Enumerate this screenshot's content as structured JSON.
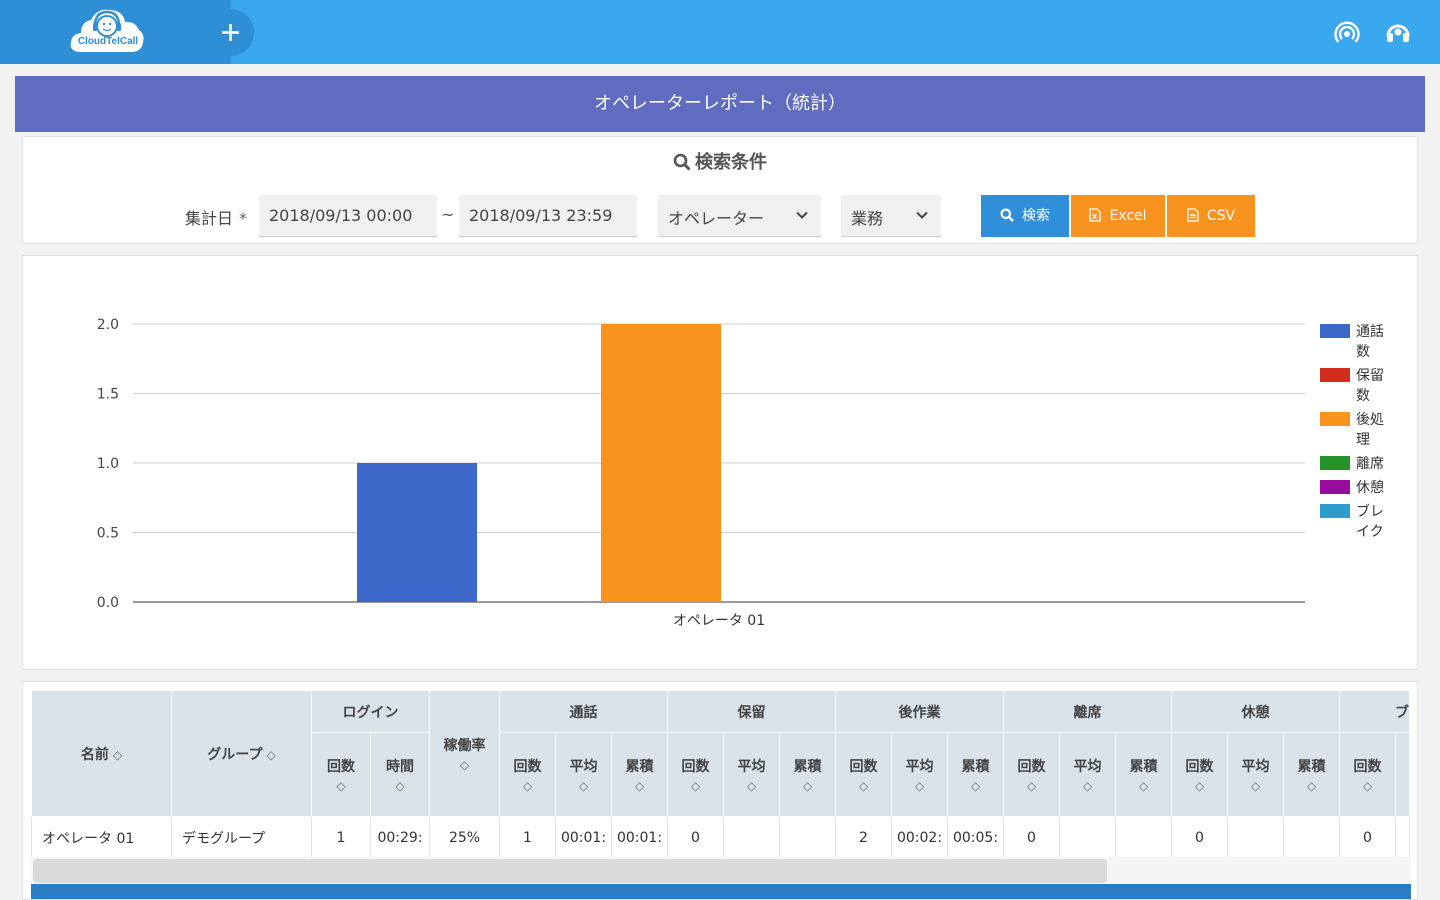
{
  "header": {
    "logo_text": "CloudTelCall",
    "brand_color": "#39a8ef",
    "logo_bg": "#2e8fd6",
    "icons": [
      "plus-icon",
      "broadcast-icon",
      "headset-icon"
    ]
  },
  "title": "オペレーターレポート（統計）",
  "search": {
    "heading": "検索条件",
    "date_label": "集計日",
    "required_mark": "*",
    "date_from": "2018/09/13 00:00",
    "tilde": "~",
    "date_to": "2018/09/13 23:59",
    "operator_select": "オペレーター",
    "task_select": "業務",
    "search_button": "検索",
    "excel_button": "Excel",
    "csv_button": "CSV"
  },
  "chart_data": {
    "type": "bar",
    "categories": [
      "オペレータ 01"
    ],
    "series": [
      {
        "name": "通話数",
        "values": [
          1
        ],
        "color": "#3d67c9"
      },
      {
        "name": "保留数",
        "values": [
          0
        ],
        "color": "#d42b1f"
      },
      {
        "name": "後処理",
        "values": [
          2
        ],
        "color": "#f7931e"
      },
      {
        "name": "離席",
        "values": [
          0
        ],
        "color": "#26922c"
      },
      {
        "name": "休憩",
        "values": [
          0
        ],
        "color": "#960c9a"
      },
      {
        "name": "ブレイク",
        "values": [
          0
        ],
        "color": "#2e9ccc"
      }
    ],
    "yticks": [
      "0.0",
      "0.5",
      "1.0",
      "1.5",
      "2.0"
    ],
    "ylim": [
      0,
      2
    ],
    "grid": true,
    "legend": "right"
  },
  "legend": {
    "items": [
      {
        "name": "通話数",
        "line1": "通話",
        "line2": "数",
        "color": "#3d67c9"
      },
      {
        "name": "保留数",
        "line1": "保留",
        "line2": "数",
        "color": "#d42b1f"
      },
      {
        "name": "後処理",
        "line1": "後処",
        "line2": "理",
        "color": "#f7931e"
      },
      {
        "name": "離席",
        "line1": "離席",
        "line2": "",
        "color": "#26922c"
      },
      {
        "name": "休憩",
        "line1": "休憩",
        "line2": "",
        "color": "#960c9a"
      },
      {
        "name": "ブレイク",
        "line1": "ブレ",
        "line2": "イク",
        "color": "#2e9ccc"
      }
    ]
  },
  "table": {
    "groups": {
      "login": "ログイン",
      "util": "稼働率",
      "call": "通話",
      "hold": "保留",
      "after": "後作業",
      "away": "離席",
      "rest": "休憩",
      "break": "ブ"
    },
    "cols": {
      "name": "名前",
      "group": "グループ",
      "count": "回数",
      "time": "時間",
      "avg": "平均",
      "total": "累積"
    },
    "sort_glyph": "◇",
    "row": {
      "name": "オペレータ 01",
      "group": "デモグループ",
      "login_count": "1",
      "login_time": "00:29:",
      "util": "25%",
      "call_count": "1",
      "call_avg": "00:01:",
      "call_total": "00:01:",
      "hold_count": "0",
      "after_count": "2",
      "after_avg": "00:02:",
      "after_total": "00:05:",
      "away_count": "0",
      "rest_count": "0",
      "break_count": "0"
    }
  }
}
